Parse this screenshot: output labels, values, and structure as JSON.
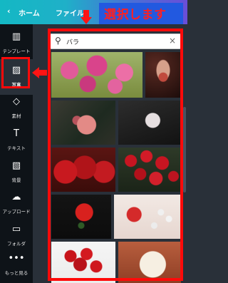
{
  "topbar": {
    "back_icon": "‹",
    "home_label": "ホーム",
    "file_label": "ファイル"
  },
  "callout": {
    "text": "選択します"
  },
  "sidebar": {
    "items": [
      {
        "label": "テンプレート",
        "icon": "grid-icon",
        "glyph": "▥"
      },
      {
        "label": "写真",
        "icon": "photo-icon",
        "glyph": "▨"
      },
      {
        "label": "素材",
        "icon": "shapes-icon",
        "glyph": "◇"
      },
      {
        "label": "テキスト",
        "icon": "text-icon",
        "glyph": "T"
      },
      {
        "label": "背景",
        "icon": "background-icon",
        "glyph": "▧"
      },
      {
        "label": "アップロード",
        "icon": "upload-icon",
        "glyph": "☁"
      },
      {
        "label": "フォルダ",
        "icon": "folder-icon",
        "glyph": "▭"
      },
      {
        "label": "もっと見る",
        "icon": "more-icon",
        "glyph": "•••"
      }
    ],
    "active_index": 1
  },
  "search": {
    "value": "バラ",
    "icon": "search-icon",
    "clear_icon": "close-icon"
  },
  "photos": [
    {
      "name": "pink-roses-bouquet"
    },
    {
      "name": "woman-with-rose"
    },
    {
      "name": "pink-rose-dark"
    },
    {
      "name": "white-rose-dark"
    },
    {
      "name": "three-red-roses"
    },
    {
      "name": "red-rose-cluster"
    },
    {
      "name": "single-red-rose"
    },
    {
      "name": "rose-pearls"
    },
    {
      "name": "red-rose-bouquet-white"
    },
    {
      "name": "white-rose-peach"
    }
  ],
  "colors": {
    "accent": "#ff0a0a",
    "sidebar_bg": "#0e1318",
    "panel_bg": "#293039"
  }
}
